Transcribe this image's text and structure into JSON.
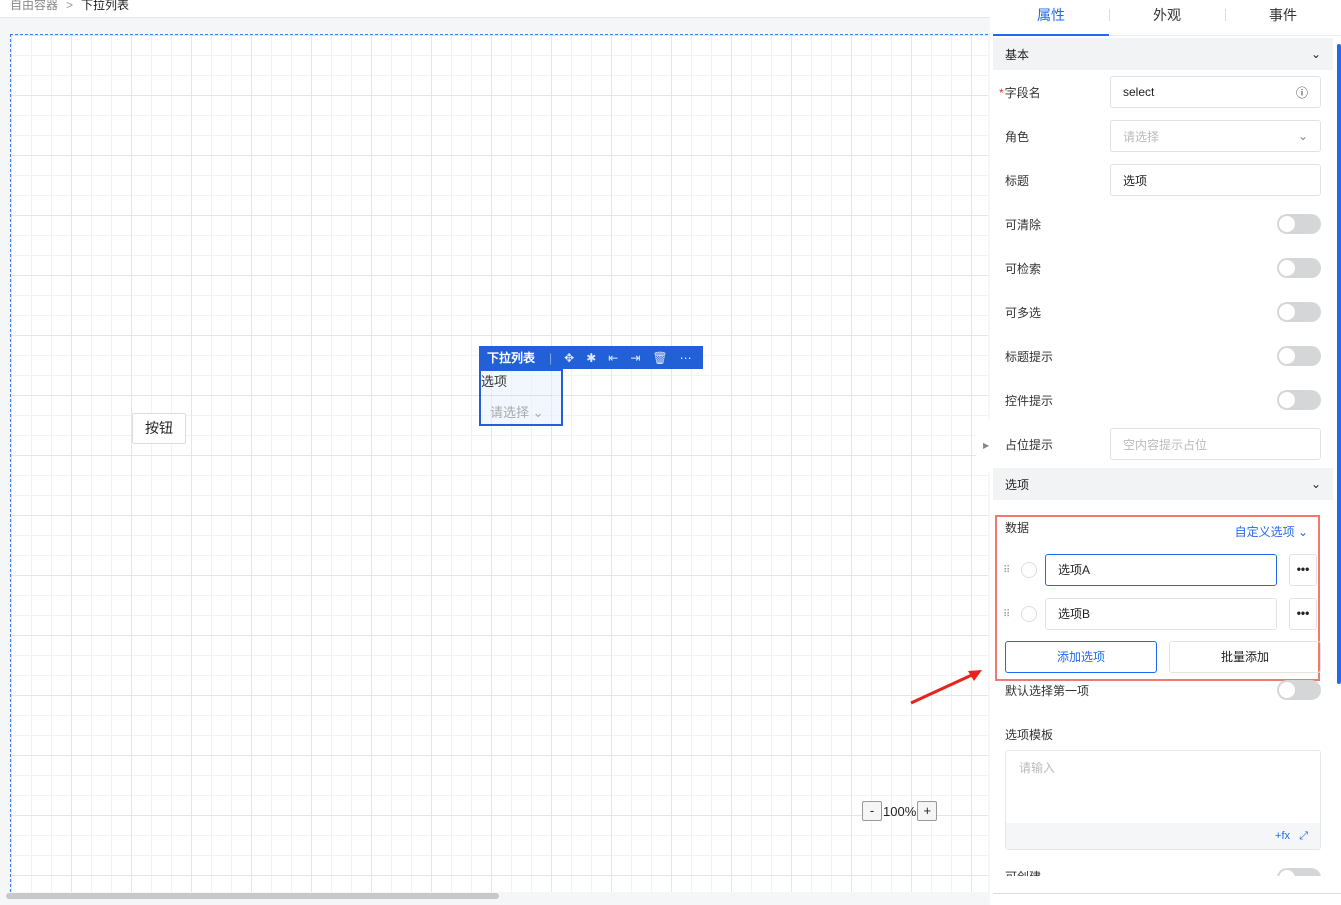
{
  "breadcrumb": {
    "parent": "自由容器",
    "sep": ">",
    "current": "下拉列表"
  },
  "canvas": {
    "button_label": "按钮",
    "select_widget": {
      "toolbar_title": "下拉列表",
      "label": "选项",
      "placeholder": "请选择"
    },
    "zoom": {
      "minus": "-",
      "level": "100%",
      "plus": "+"
    }
  },
  "panel": {
    "tabs": [
      "属性",
      "外观",
      "事件"
    ],
    "sections": {
      "basic": "基本",
      "options": "选项"
    },
    "fields": {
      "field_name": {
        "label": "字段名",
        "required": "*",
        "value": "select"
      },
      "role": {
        "label": "角色",
        "placeholder": "请选择"
      },
      "title": {
        "label": "标题",
        "value": "选项"
      },
      "clearable": "可清除",
      "searchable": "可检索",
      "multiple": "可多选",
      "title_tip": "标题提示",
      "control_tip": "控件提示",
      "placeholder": {
        "label": "占位提示",
        "placeholder": "空内容提示占位"
      }
    },
    "data": {
      "label": "数据",
      "mode": "自定义选项",
      "options": [
        "选项A",
        "选项B"
      ],
      "more": "•••",
      "add": "添加选项",
      "batch": "批量添加"
    },
    "default_first": "默认选择第一项",
    "template": {
      "label": "选项模板",
      "placeholder": "请输入",
      "fx": "+fx"
    },
    "creatable": "可创建"
  },
  "colors": {
    "accent": "#2468f2",
    "toolbar": "#2260d8",
    "highlight": "#f07a72",
    "arrow": "#e8231b"
  }
}
